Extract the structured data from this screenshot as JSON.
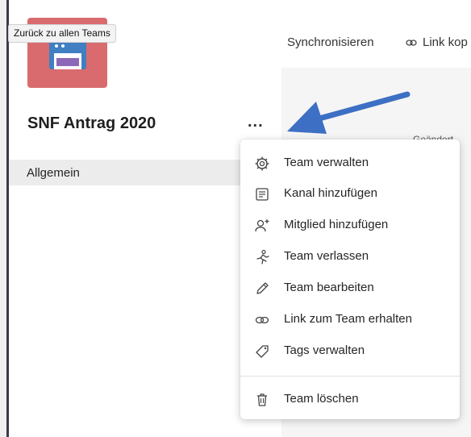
{
  "tooltip": {
    "text": "Zurück zu allen Teams"
  },
  "team": {
    "name": "SNF Antrag 2020",
    "more_label": "..."
  },
  "channels": [
    {
      "label": "Allgemein"
    }
  ],
  "toolbar": {
    "sync_label": "Synchronisieren",
    "link_label": "Link kop"
  },
  "column": {
    "modified_label": "Geändert"
  },
  "menu": {
    "items": [
      {
        "label": "Team verwalten",
        "icon": "gear-icon"
      },
      {
        "label": "Kanal hinzufügen",
        "icon": "channel-icon"
      },
      {
        "label": "Mitglied hinzufügen",
        "icon": "add-person-icon"
      },
      {
        "label": "Team verlassen",
        "icon": "leave-run-icon"
      },
      {
        "label": "Team bearbeiten",
        "icon": "pencil-icon"
      },
      {
        "label": "Link zum Team erhalten",
        "icon": "link-icon"
      },
      {
        "label": "Tags verwalten",
        "icon": "tag-icon"
      }
    ],
    "delete_item": {
      "label": "Team löschen",
      "icon": "trash-icon"
    }
  },
  "colors": {
    "avatar": "#d96b6e",
    "arrow": "#3d6fc4",
    "menu_text": "#252525",
    "selected_row": "#ececec"
  }
}
